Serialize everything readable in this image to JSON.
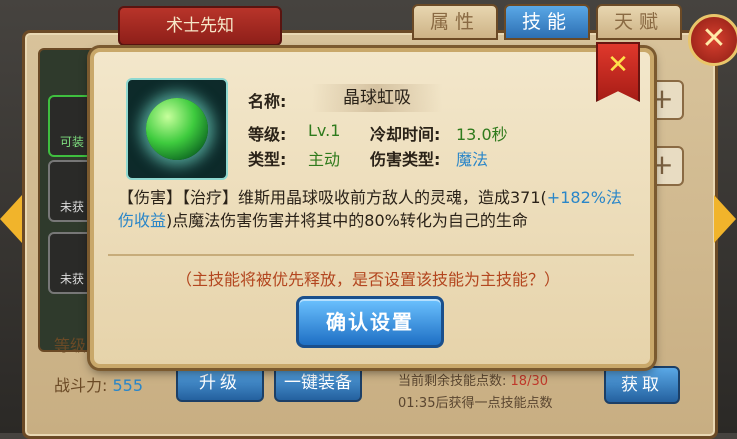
{
  "background": {
    "title": "术士先知",
    "tabs": [
      {
        "label": "属性",
        "active": false
      },
      {
        "label": "技能",
        "active": true
      },
      {
        "label": "天赋",
        "active": false
      }
    ],
    "slots": [
      {
        "label": "可装"
      },
      {
        "label": "未获"
      },
      {
        "label": "未获"
      }
    ],
    "level_label": "等级",
    "power_label": "战斗力:",
    "power_value": "555",
    "upgrade_button": "升级",
    "equip_all_button": "一键装备",
    "remaining_points_label": "当前剩余技能点数:",
    "remaining_points_value": "18/30",
    "regen_text": "01:35后获得一点技能点数",
    "obtain_button": "获取",
    "colors": {
      "accent_blue": "#2d6fb3",
      "banner_red": "#8e1f19"
    }
  },
  "dialog": {
    "skill_icon": "green-crystal-orb-icon",
    "name_label": "名称:",
    "name_value": "晶球虹吸",
    "level_label": "等级:",
    "level_value": "Lv.1",
    "cooldown_label": "冷却时间:",
    "cooldown_value": "13.0秒",
    "type_label": "类型:",
    "type_value": "主动",
    "damage_type_label": "伤害类型:",
    "damage_type_value": "魔法",
    "description_part1": "【伤害】【治疗】维斯用晶球吸收前方敌人的灵魂，造成371(",
    "description_highlight": "+182%法伤收益",
    "description_part2": ")点魔法伤害伤害并将其中的80%转化为自己的生命",
    "hint": "（主技能将被优先释放，是否设置该技能为主技能？）",
    "confirm_button": "确认设置",
    "close_icon": "close-x-icon"
  }
}
